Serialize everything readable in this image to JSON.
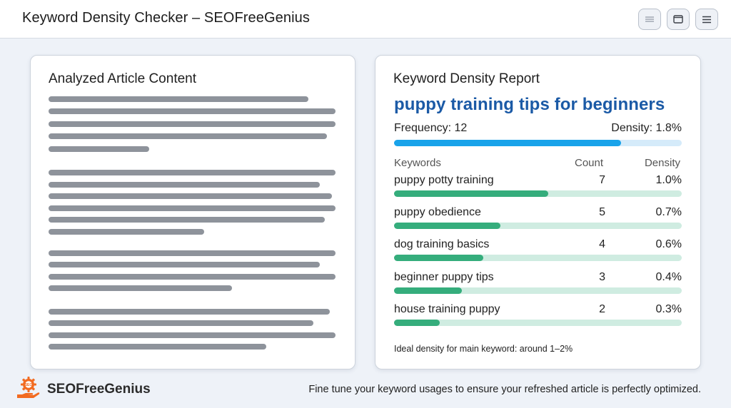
{
  "app": {
    "title": "Keyword Density Checker – SEOFreeGenius"
  },
  "window_controls": [
    {
      "name": "list-view-icon"
    },
    {
      "name": "window-icon"
    },
    {
      "name": "menu-icon"
    }
  ],
  "article_panel": {
    "title": "Analyzed Article Content"
  },
  "report": {
    "title": "Keyword Density Report",
    "main_keyword": "puppy training tips for beginners",
    "frequency": "Frequency: 12",
    "density": "Density: 1.8%",
    "density_progress": 0.79,
    "columns": {
      "keywords": "Keywords",
      "count": "Count",
      "density": "Density"
    },
    "rows": [
      {
        "keyword": "puppy potty training",
        "count": "7",
        "density": "1.0%",
        "progress": 0.535
      },
      {
        "keyword": "puppy obedience",
        "count": "5",
        "density": "0.7%",
        "progress": 0.37
      },
      {
        "keyword": "dog training basics",
        "count": "4",
        "density": "0.6%",
        "progress": 0.31
      },
      {
        "keyword": "beginner puppy tips",
        "count": "3",
        "density": "0.4%",
        "progress": 0.235
      },
      {
        "keyword": "house training puppy",
        "count": "2",
        "density": "0.3%",
        "progress": 0.16
      }
    ],
    "note": "Ideal density for main keyword: around 1–2%"
  },
  "footer": {
    "brand": "SEOFreeGenius",
    "logo_icon": "gear-hand-logo-icon",
    "tagline": "Fine tune your keyword usages to ensure your refreshed article is perfectly optimized."
  },
  "colors": {
    "main_keyword": "#1b5aa6",
    "main_bar": "#19a3ea",
    "keyword_bar": "#35ad7c",
    "brand_accent": "#f26b21"
  }
}
